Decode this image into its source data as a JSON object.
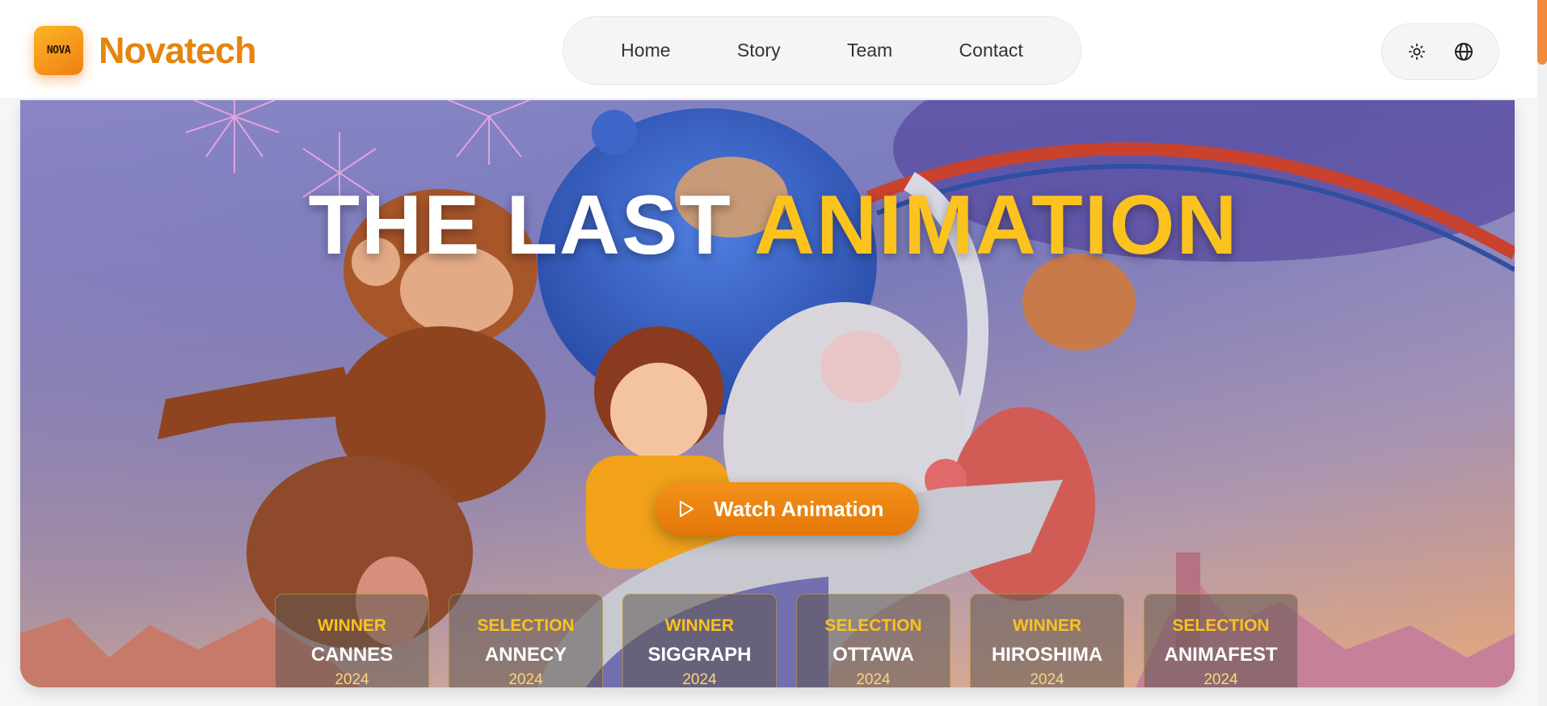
{
  "header": {
    "logo_text": "NOVA",
    "brand": "Novatech",
    "nav": [
      {
        "label": "Home"
      },
      {
        "label": "Story"
      },
      {
        "label": "Team"
      },
      {
        "label": "Contact"
      }
    ],
    "tools": [
      {
        "icon": "sun-icon"
      },
      {
        "icon": "globe-icon"
      }
    ]
  },
  "hero": {
    "title_main": "THE LAST",
    "title_accent": "ANIMATION",
    "cta_label": "Watch Animation",
    "awards": [
      {
        "status": "WINNER",
        "festival": "CANNES",
        "year": "2024"
      },
      {
        "status": "SELECTION",
        "festival": "ANNECY",
        "year": "2024"
      },
      {
        "status": "WINNER",
        "festival": "SIGGRAPH",
        "year": "2024"
      },
      {
        "status": "SELECTION",
        "festival": "OTTAWA",
        "year": "2024"
      },
      {
        "status": "WINNER",
        "festival": "HIROSHIMA",
        "year": "2024"
      },
      {
        "status": "SELECTION",
        "festival": "ANIMAFEST",
        "year": "2024"
      }
    ]
  },
  "colors": {
    "brand": "#e4850f",
    "accent": "#fcc21e",
    "button": "#f08a14"
  }
}
